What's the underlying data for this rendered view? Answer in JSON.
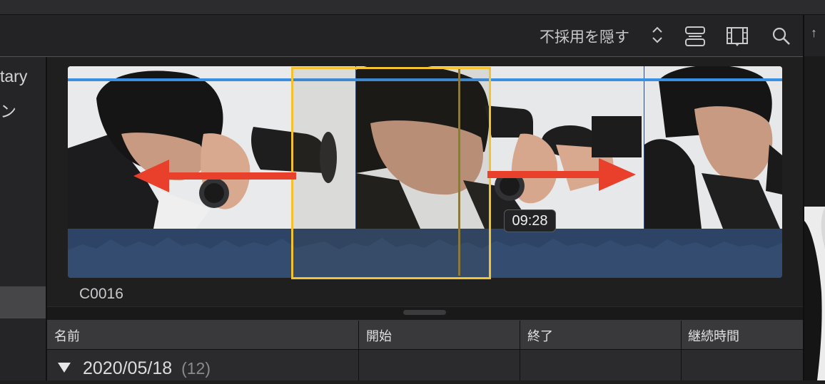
{
  "toolbar": {
    "filter_label": "不採用を隠す",
    "icons": [
      "stepper-chevrons-icon",
      "clip-appearance-icon",
      "filmstrip-icon",
      "search-icon"
    ]
  },
  "sidebar": {
    "items": [
      "tary",
      "ン"
    ]
  },
  "clip": {
    "name": "C0016",
    "skim_time": "09:28"
  },
  "list": {
    "columns": [
      "名前",
      "開始",
      "終了",
      "継続時間"
    ],
    "group": {
      "date": "2020/05/18",
      "count": "(12)"
    }
  },
  "colors": {
    "selection": "#f2c230",
    "playhead_line": "#3b8fe3",
    "annotation_arrow": "#e8402b",
    "audio_waveform": "#2e4467"
  }
}
